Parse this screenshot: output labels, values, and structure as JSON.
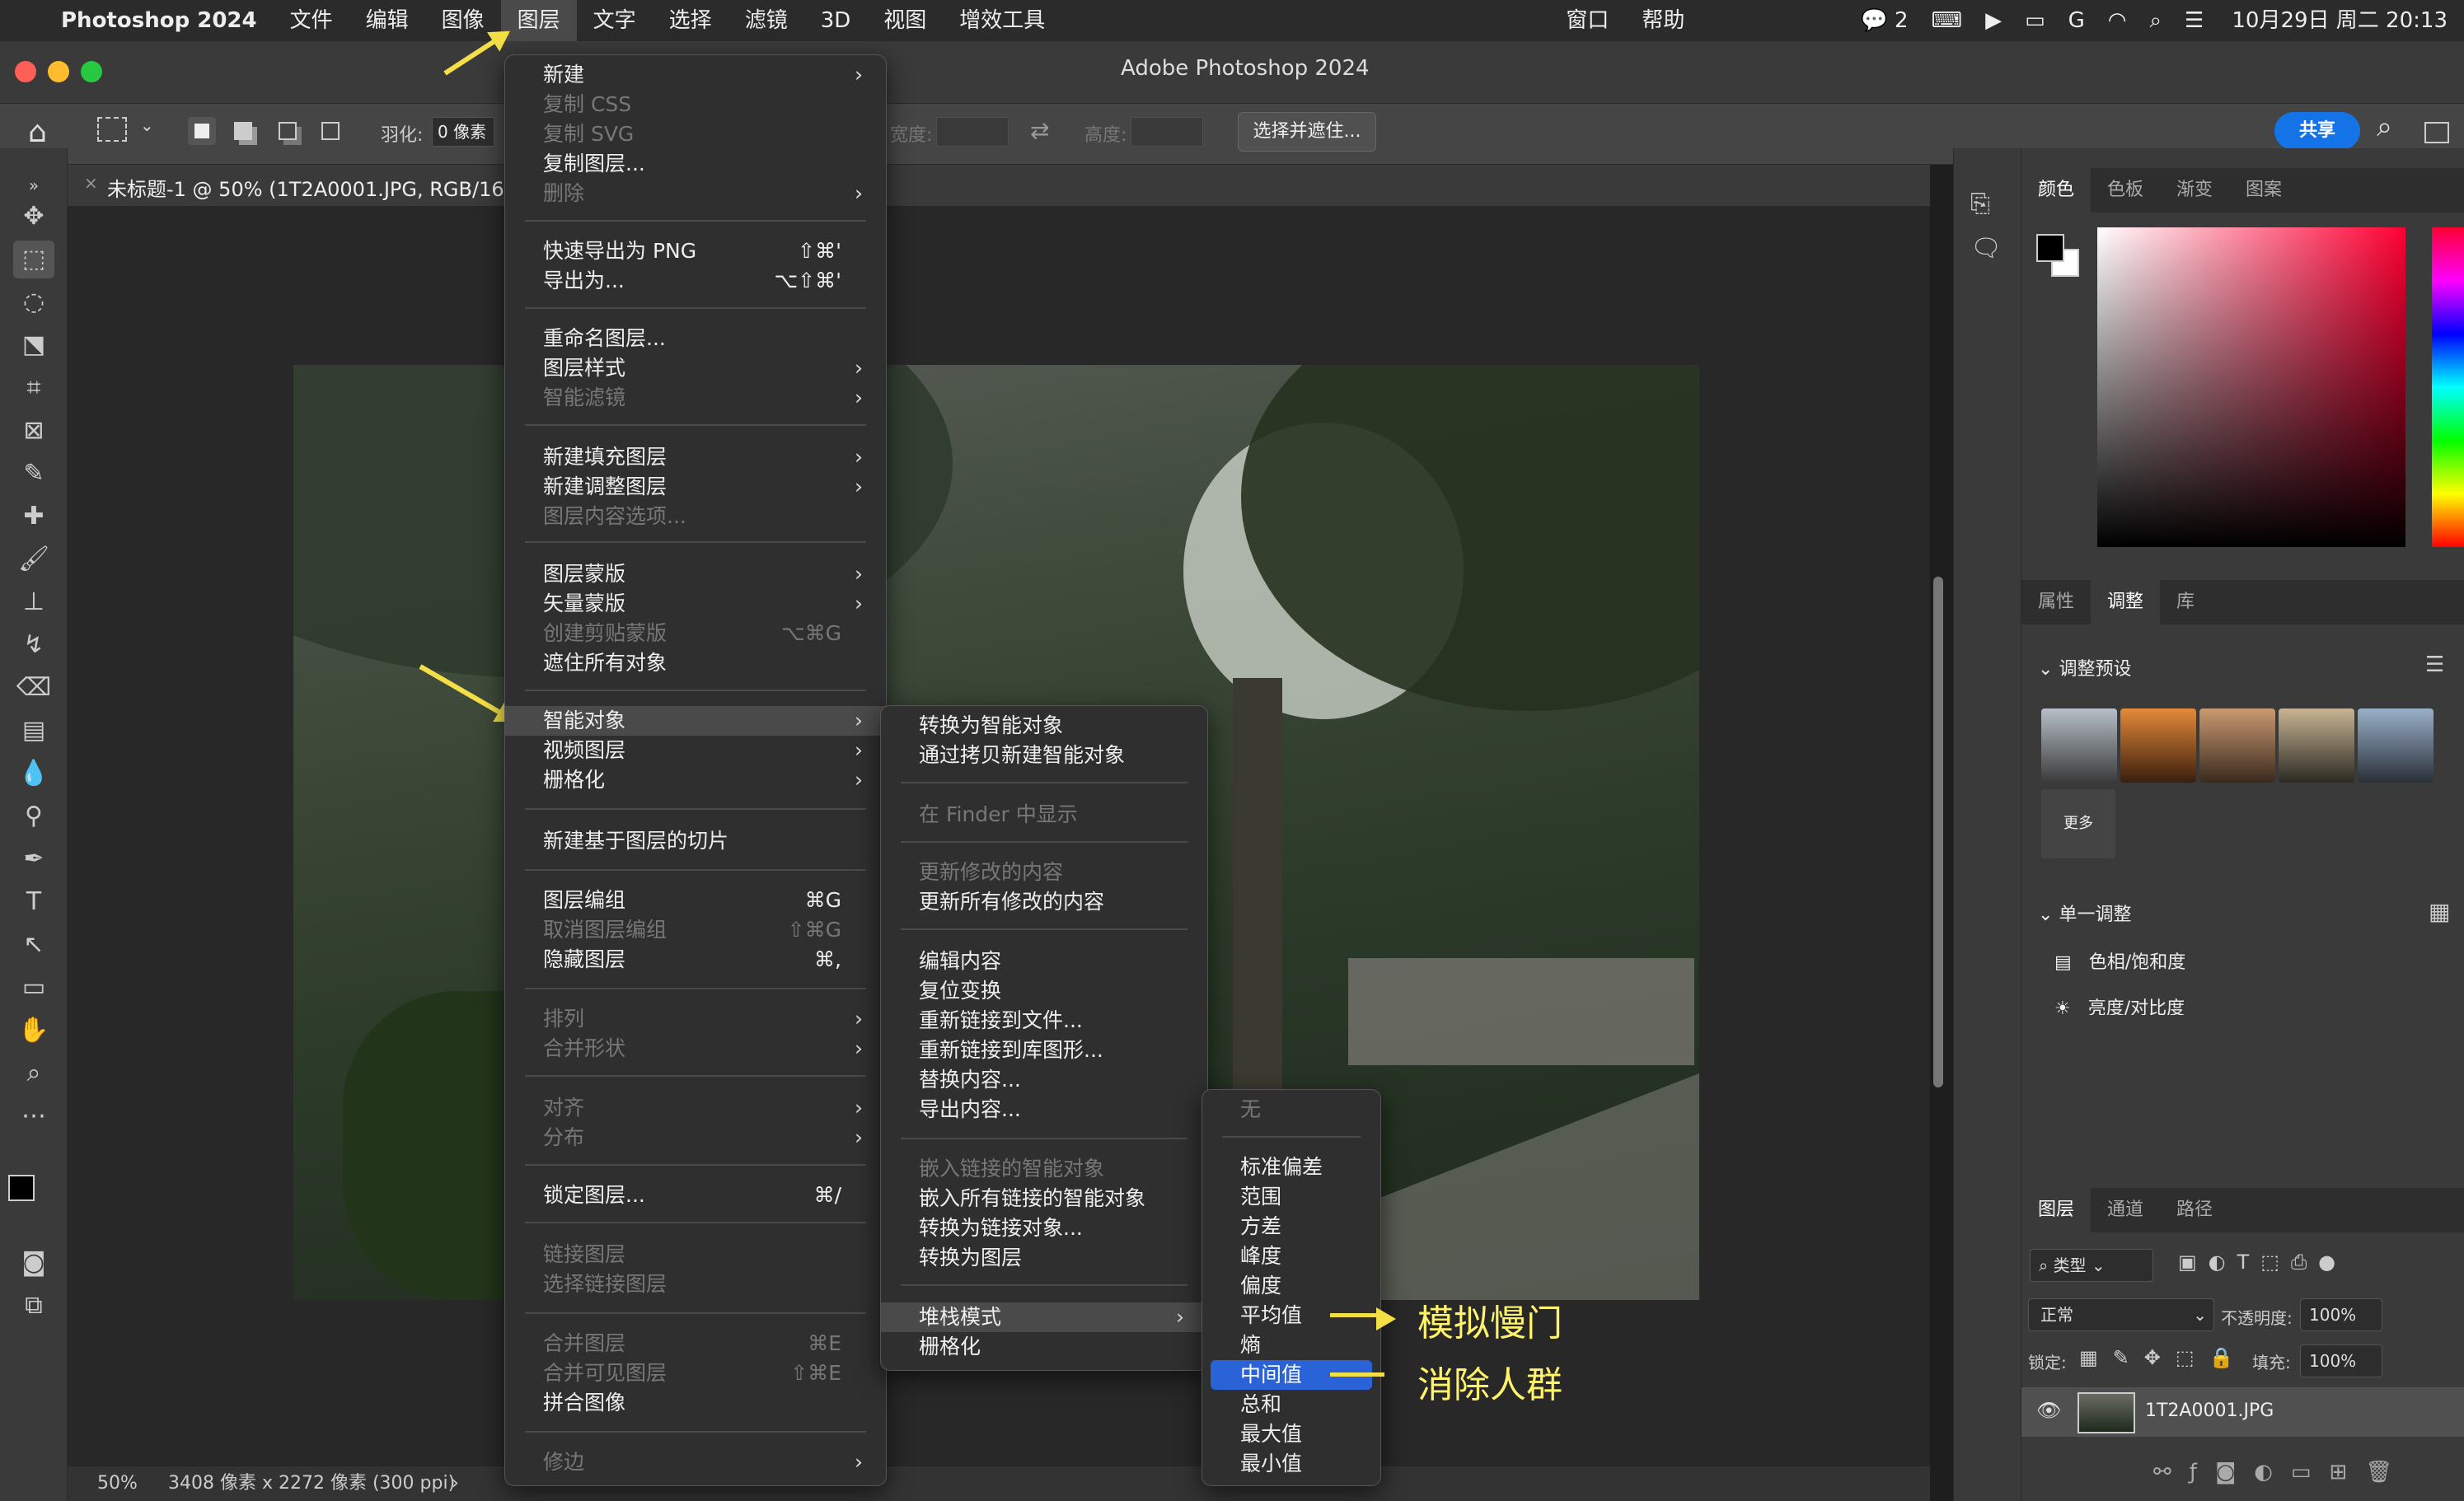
{
  "menubar": {
    "app": "Photoshop 2024",
    "items": [
      "文件",
      "编辑",
      "图像",
      "图层",
      "文字",
      "选择",
      "滤镜",
      "3D",
      "视图",
      "增效工具"
    ],
    "right_items": [
      "窗口",
      "帮助"
    ],
    "wechat_count": "2",
    "datetime": "10月29日 周二 20:13"
  },
  "window": {
    "title": "Adobe Photoshop 2024"
  },
  "options": {
    "feather_label": "羽化:",
    "feather_value": "0 像素",
    "width_label": "宽度:",
    "height_label": "高度:",
    "select_mask": "选择并遮住...",
    "share": "共享"
  },
  "document": {
    "tab_title": "未标题-1 @ 50% (1T2A0001.JPG, RGB/16*",
    "zoom": "50%",
    "info": "3408 像素 x 2272 像素 (300 ppi)"
  },
  "layer_menu": [
    {
      "label": "新建",
      "arrow": true
    },
    {
      "label": "复制 CSS",
      "dis": true
    },
    {
      "label": "复制 SVG",
      "dis": true
    },
    {
      "label": "复制图层..."
    },
    {
      "label": "删除",
      "dis": true,
      "arrow": true
    },
    {
      "label": "快速导出为 PNG",
      "sc": "⇧⌘'"
    },
    {
      "label": "导出为...",
      "sc": "⌥⇧⌘'"
    },
    {
      "label": "重命名图层..."
    },
    {
      "label": "图层样式",
      "arrow": true
    },
    {
      "label": "智能滤镜",
      "dis": true,
      "arrow": true
    },
    {
      "label": "新建填充图层",
      "arrow": true
    },
    {
      "label": "新建调整图层",
      "arrow": true
    },
    {
      "label": "图层内容选项...",
      "dis": true
    },
    {
      "label": "图层蒙版",
      "arrow": true
    },
    {
      "label": "矢量蒙版",
      "arrow": true
    },
    {
      "label": "创建剪贴蒙版",
      "dis": true,
      "sc": "⌥⌘G"
    },
    {
      "label": "遮住所有对象"
    },
    {
      "label": "智能对象",
      "arrow": true,
      "hl": true
    },
    {
      "label": "视频图层",
      "arrow": true
    },
    {
      "label": "栅格化",
      "arrow": true
    },
    {
      "label": "新建基于图层的切片"
    },
    {
      "label": "图层编组",
      "sc": "⌘G"
    },
    {
      "label": "取消图层编组",
      "dis": true,
      "sc": "⇧⌘G"
    },
    {
      "label": "隐藏图层",
      "sc": "⌘,"
    },
    {
      "label": "排列",
      "dis": true,
      "arrow": true
    },
    {
      "label": "合并形状",
      "dis": true,
      "arrow": true
    },
    {
      "label": "对齐",
      "dis": true,
      "arrow": true
    },
    {
      "label": "分布",
      "dis": true,
      "arrow": true
    },
    {
      "label": "锁定图层...",
      "sc": "⌘/"
    },
    {
      "label": "链接图层",
      "dis": true
    },
    {
      "label": "选择链接图层",
      "dis": true
    },
    {
      "label": "合并图层",
      "dis": true,
      "sc": "⌘E"
    },
    {
      "label": "合并可见图层",
      "dis": true,
      "sc": "⇧⌘E"
    },
    {
      "label": "拼合图像"
    },
    {
      "label": "修边",
      "dis": true,
      "arrow": true
    }
  ],
  "smart_menu": [
    {
      "label": "转换为智能对象"
    },
    {
      "label": "通过拷贝新建智能对象"
    },
    {
      "label": "在 Finder 中显示",
      "dis": true
    },
    {
      "label": "更新修改的内容",
      "dis": true
    },
    {
      "label": "更新所有修改的内容"
    },
    {
      "label": "编辑内容"
    },
    {
      "label": "复位变换"
    },
    {
      "label": "重新链接到文件..."
    },
    {
      "label": "重新链接到库图形..."
    },
    {
      "label": "替换内容..."
    },
    {
      "label": "导出内容..."
    },
    {
      "label": "嵌入链接的智能对象",
      "dis": true
    },
    {
      "label": "嵌入所有链接的智能对象"
    },
    {
      "label": "转换为链接对象..."
    },
    {
      "label": "转换为图层"
    },
    {
      "label": "堆栈模式",
      "arrow": true,
      "hl": true
    },
    {
      "label": "栅格化"
    }
  ],
  "stack_menu": [
    {
      "label": "无",
      "dis": true
    },
    {
      "label": "标准偏差"
    },
    {
      "label": "范围"
    },
    {
      "label": "方差"
    },
    {
      "label": "峰度"
    },
    {
      "label": "偏度"
    },
    {
      "label": "平均值"
    },
    {
      "label": "熵"
    },
    {
      "label": "中间值",
      "sel": true
    },
    {
      "label": "总和"
    },
    {
      "label": "最大值"
    },
    {
      "label": "最小值"
    }
  ],
  "annotations": {
    "mean": "模拟慢门",
    "median": "消除人群"
  },
  "panels": {
    "color_tabs": [
      "颜色",
      "色板",
      "渐变",
      "图案"
    ],
    "adj_tabs": [
      "属性",
      "调整",
      "库"
    ],
    "adj_presets_title": "调整预设",
    "more": "更多",
    "single_adj_title": "单一调整",
    "single_adj_items": [
      "色相/饱和度",
      "亮度/对比度"
    ],
    "layer_tabs": [
      "图层",
      "通道",
      "路径"
    ],
    "kind_filter": "类型",
    "blend_mode": "正常",
    "opacity_label": "不透明度:",
    "opacity_value": "100%",
    "lock_label": "锁定:",
    "fill_label": "填充:",
    "fill_value": "100%",
    "layer_name": "1T2A0001.JPG"
  },
  "colors": {
    "accent": "#2a62d8",
    "annotation": "#f4e046",
    "menu_bg": "#2f2f2f"
  }
}
